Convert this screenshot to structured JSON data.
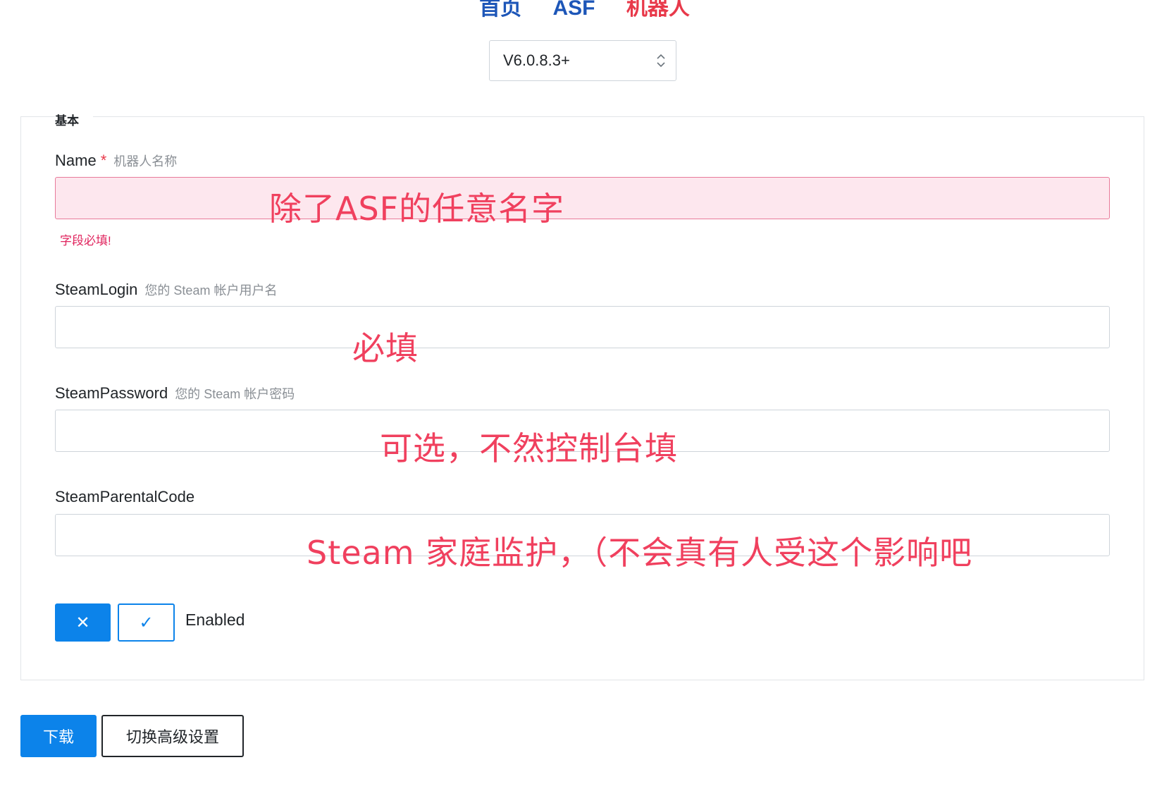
{
  "nav": {
    "home": "首页",
    "asf": "ASF",
    "bot": "机器人"
  },
  "version_select": {
    "value": "V6.0.8.3+"
  },
  "section": {
    "legend": "基本"
  },
  "fields": {
    "name": {
      "label": "Name",
      "required_mark": "*",
      "hint": "机器人名称",
      "value": "",
      "error": "字段必填!"
    },
    "steam_login": {
      "label": "SteamLogin",
      "hint": "您的 Steam 帐户用户名",
      "value": ""
    },
    "steam_password": {
      "label": "SteamPassword",
      "hint": "您的 Steam 帐户密码",
      "value": ""
    },
    "steam_parental_code": {
      "label": "SteamParentalCode",
      "value": ""
    }
  },
  "annotations": {
    "name": "除了ASF的任意名字",
    "login": "必填",
    "password": "可选，不然控制台填",
    "parental": "Steam 家庭监护，（不会真有人受这个影响吧"
  },
  "enabled_toggle": {
    "off_symbol": "✕",
    "on_symbol": "✓",
    "label": "Enabled",
    "state": "off"
  },
  "buttons": {
    "download": "下载",
    "advanced": "切换高级设置"
  },
  "colors": {
    "primary": "#0c83ea",
    "annotation": "#f0405e",
    "error": "#e0245e",
    "nav_active": "#e8394a"
  }
}
